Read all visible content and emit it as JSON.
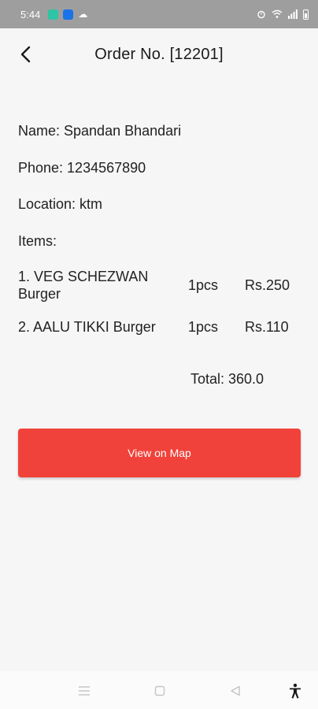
{
  "status_bar": {
    "time": "5:44"
  },
  "header": {
    "title": "Order No. [12201]"
  },
  "customer": {
    "name": "Name: Spandan Bhandari",
    "phone": "Phone: 1234567890",
    "location": "Location: ktm"
  },
  "items_label": "Items:",
  "items": [
    {
      "name": "1. VEG SCHEZWAN Burger",
      "qty": "1pcs",
      "price": "Rs.250"
    },
    {
      "name": "2. AALU TIKKI Burger",
      "qty": "1pcs",
      "price": "Rs.110"
    }
  ],
  "total": "Total: 360.0",
  "actions": {
    "view_map_label": "View on Map"
  },
  "colors": {
    "accent": "#f0423a",
    "status_bar": "#9e9e9e"
  },
  "icons": {
    "back": "back-arrow-icon",
    "nav_recents": "menu-lines-icon",
    "nav_home": "square-icon",
    "nav_back": "triangle-back-icon",
    "accessibility": "accessibility-icon"
  }
}
